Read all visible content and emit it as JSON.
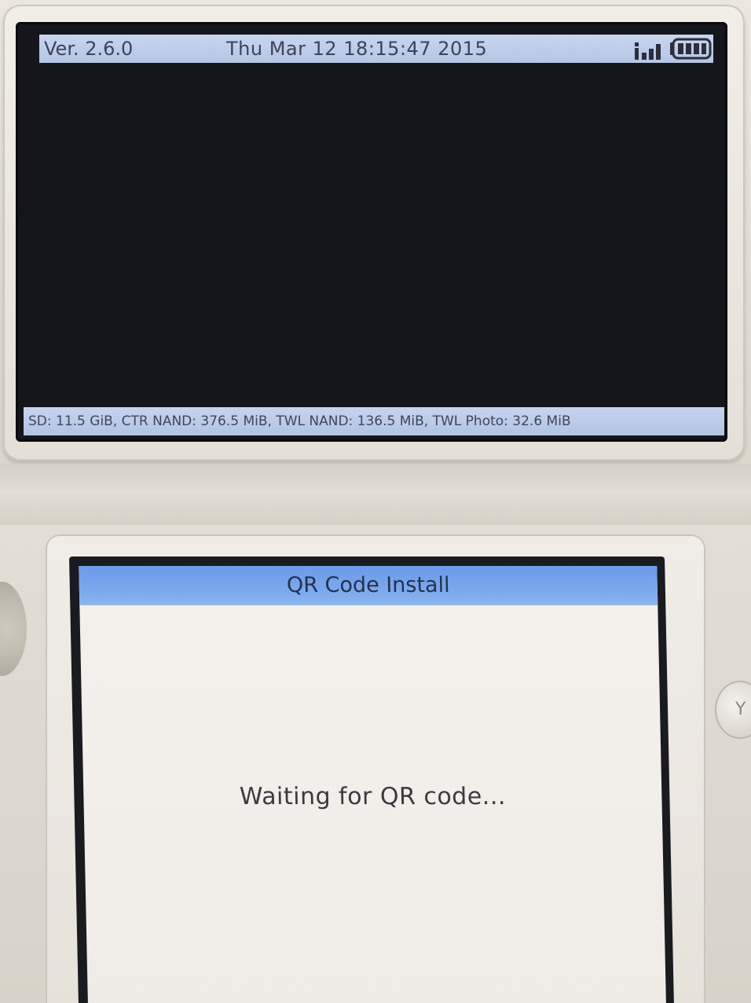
{
  "top_screen": {
    "version": "Ver. 2.6.0",
    "datetime": "Thu Mar 12 18:15:47 2015",
    "signal_icon": "signal-strength-icon",
    "battery_icon": "battery-icon",
    "storage_info": "SD: 11.5 GiB, CTR NAND: 376.5 MiB, TWL NAND: 136.5 MiB, TWL Photo: 32.6 MiB"
  },
  "bottom_screen": {
    "title": "QR Code Install",
    "message": "Waiting for QR code..."
  },
  "device": {
    "y_button_label": "Y"
  },
  "colors": {
    "top_bar": "#b8c9e8",
    "title_bar": "#7aa8ee",
    "screen_background": "#f1ede8",
    "top_screen_background": "#14161b"
  }
}
